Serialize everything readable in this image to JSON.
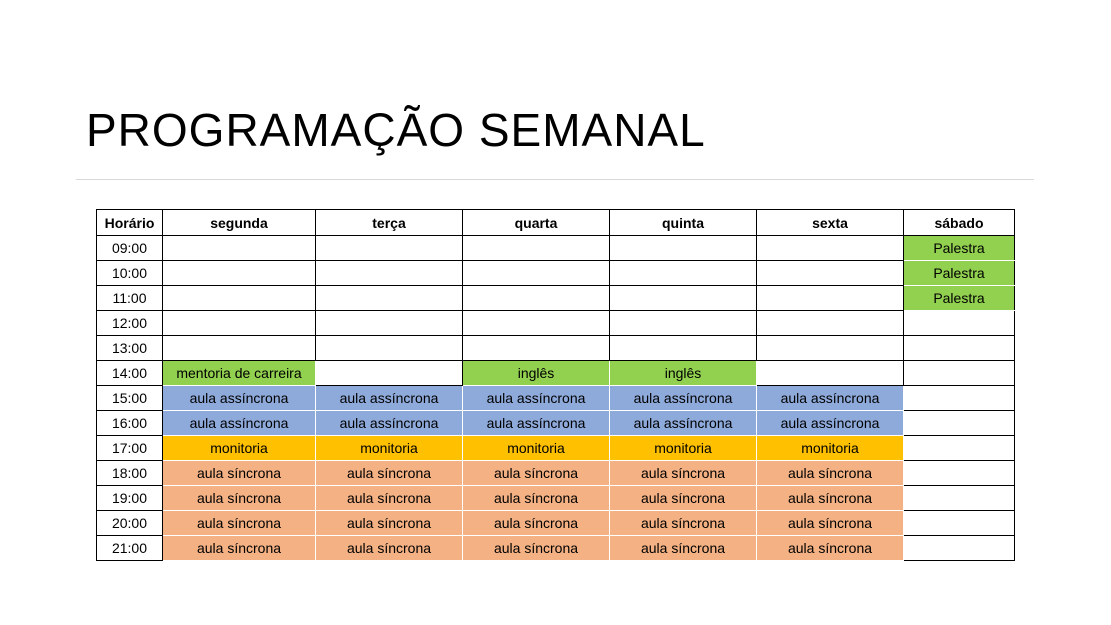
{
  "title": "PROGRAMAÇÃO SEMANAL",
  "colors": {
    "green": "#92d050",
    "blue": "#8eaadb",
    "orange": "#ffc000",
    "salmon": "#f4b183"
  },
  "table": {
    "headers": [
      "Horário",
      "segunda",
      "terça",
      "quarta",
      "quinta",
      "sexta",
      "sábado"
    ],
    "rows": [
      {
        "hour": "09:00",
        "cells": [
          {
            "text": "",
            "color": ""
          },
          {
            "text": "",
            "color": ""
          },
          {
            "text": "",
            "color": ""
          },
          {
            "text": "",
            "color": ""
          },
          {
            "text": "",
            "color": ""
          },
          {
            "text": "Palestra",
            "color": "green"
          }
        ]
      },
      {
        "hour": "10:00",
        "cells": [
          {
            "text": "",
            "color": ""
          },
          {
            "text": "",
            "color": ""
          },
          {
            "text": "",
            "color": ""
          },
          {
            "text": "",
            "color": ""
          },
          {
            "text": "",
            "color": ""
          },
          {
            "text": "Palestra",
            "color": "green"
          }
        ]
      },
      {
        "hour": "11:00",
        "cells": [
          {
            "text": "",
            "color": ""
          },
          {
            "text": "",
            "color": ""
          },
          {
            "text": "",
            "color": ""
          },
          {
            "text": "",
            "color": ""
          },
          {
            "text": "",
            "color": ""
          },
          {
            "text": "Palestra",
            "color": "green"
          }
        ]
      },
      {
        "hour": "12:00",
        "cells": [
          {
            "text": "",
            "color": ""
          },
          {
            "text": "",
            "color": ""
          },
          {
            "text": "",
            "color": ""
          },
          {
            "text": "",
            "color": ""
          },
          {
            "text": "",
            "color": ""
          },
          {
            "text": "",
            "color": ""
          }
        ]
      },
      {
        "hour": "13:00",
        "cells": [
          {
            "text": "",
            "color": ""
          },
          {
            "text": "",
            "color": ""
          },
          {
            "text": "",
            "color": ""
          },
          {
            "text": "",
            "color": ""
          },
          {
            "text": "",
            "color": ""
          },
          {
            "text": "",
            "color": ""
          }
        ]
      },
      {
        "hour": "14:00",
        "cells": [
          {
            "text": "mentoria de carreira",
            "color": "green"
          },
          {
            "text": "",
            "color": ""
          },
          {
            "text": "inglês",
            "color": "green"
          },
          {
            "text": "inglês",
            "color": "green"
          },
          {
            "text": "",
            "color": ""
          },
          {
            "text": "",
            "color": ""
          }
        ]
      },
      {
        "hour": "15:00",
        "cells": [
          {
            "text": "aula assíncrona",
            "color": "blue"
          },
          {
            "text": "aula assíncrona",
            "color": "blue"
          },
          {
            "text": "aula assíncrona",
            "color": "blue"
          },
          {
            "text": "aula assíncrona",
            "color": "blue"
          },
          {
            "text": "aula assíncrona",
            "color": "blue"
          },
          {
            "text": "",
            "color": ""
          }
        ]
      },
      {
        "hour": "16:00",
        "cells": [
          {
            "text": "aula assíncrona",
            "color": "blue"
          },
          {
            "text": "aula assíncrona",
            "color": "blue"
          },
          {
            "text": "aula assíncrona",
            "color": "blue"
          },
          {
            "text": "aula assíncrona",
            "color": "blue"
          },
          {
            "text": "aula assíncrona",
            "color": "blue"
          },
          {
            "text": "",
            "color": ""
          }
        ]
      },
      {
        "hour": "17:00",
        "cells": [
          {
            "text": "monitoria",
            "color": "orange"
          },
          {
            "text": "monitoria",
            "color": "orange"
          },
          {
            "text": "monitoria",
            "color": "orange"
          },
          {
            "text": "monitoria",
            "color": "orange"
          },
          {
            "text": "monitoria",
            "color": "orange"
          },
          {
            "text": "",
            "color": ""
          }
        ]
      },
      {
        "hour": "18:00",
        "cells": [
          {
            "text": "aula síncrona",
            "color": "salmon"
          },
          {
            "text": "aula síncrona",
            "color": "salmon"
          },
          {
            "text": "aula síncrona",
            "color": "salmon"
          },
          {
            "text": "aula síncrona",
            "color": "salmon"
          },
          {
            "text": "aula síncrona",
            "color": "salmon"
          },
          {
            "text": "",
            "color": ""
          }
        ]
      },
      {
        "hour": "19:00",
        "cells": [
          {
            "text": "aula síncrona",
            "color": "salmon"
          },
          {
            "text": "aula síncrona",
            "color": "salmon"
          },
          {
            "text": "aula síncrona",
            "color": "salmon"
          },
          {
            "text": "aula síncrona",
            "color": "salmon"
          },
          {
            "text": "aula síncrona",
            "color": "salmon"
          },
          {
            "text": "",
            "color": ""
          }
        ]
      },
      {
        "hour": "20:00",
        "cells": [
          {
            "text": "aula síncrona",
            "color": "salmon"
          },
          {
            "text": "aula síncrona",
            "color": "salmon"
          },
          {
            "text": "aula síncrona",
            "color": "salmon"
          },
          {
            "text": "aula síncrona",
            "color": "salmon"
          },
          {
            "text": "aula síncrona",
            "color": "salmon"
          },
          {
            "text": "",
            "color": ""
          }
        ]
      },
      {
        "hour": "21:00",
        "cells": [
          {
            "text": "aula síncrona",
            "color": "salmon"
          },
          {
            "text": "aula síncrona",
            "color": "salmon"
          },
          {
            "text": "aula síncrona",
            "color": "salmon"
          },
          {
            "text": "aula síncrona",
            "color": "salmon"
          },
          {
            "text": "aula síncrona",
            "color": "salmon"
          },
          {
            "text": "",
            "color": ""
          }
        ]
      }
    ]
  }
}
